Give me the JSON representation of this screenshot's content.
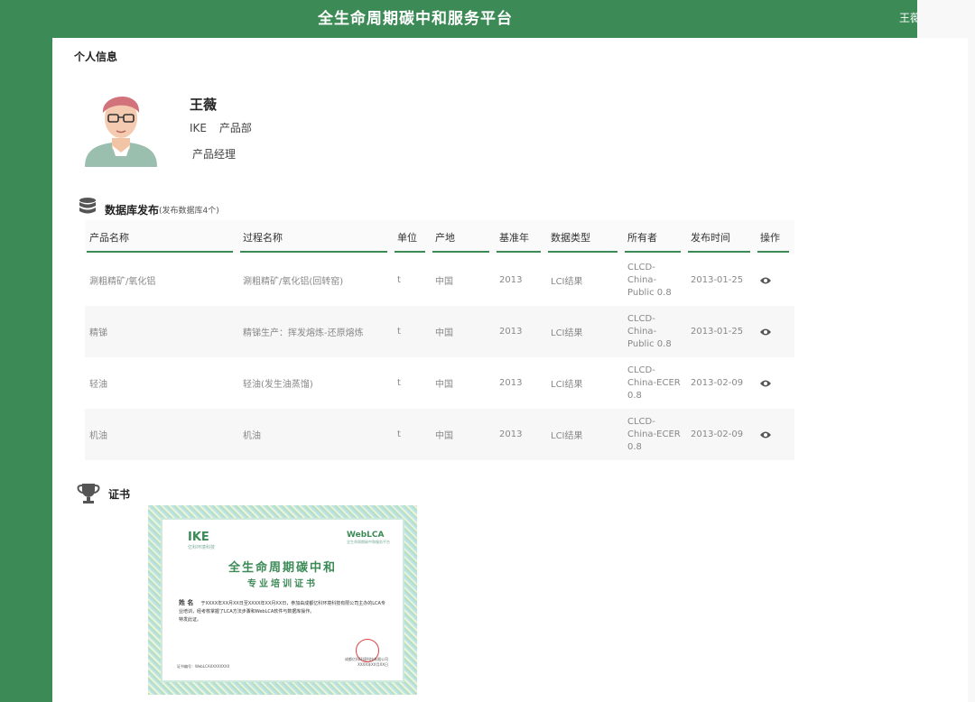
{
  "app": {
    "title": "全生命周期碳中和服务平台",
    "user_name": "王薇"
  },
  "profile": {
    "section_title": "个人信息",
    "name": "王薇",
    "company": "IKE",
    "department": "产品部",
    "role": "产品经理"
  },
  "database": {
    "title": "数据库发布",
    "subtitle": "(发布数据库4个)",
    "columns": [
      "产品名称",
      "过程名称",
      "单位",
      "产地",
      "基准年",
      "数据类型",
      "所有者",
      "发布时间",
      "操作"
    ],
    "rows": [
      {
        "product": "涮粗精矿/氧化铝",
        "process": "涮粗精矿/氧化铝(回转窑)",
        "unit": "t",
        "origin": "中国",
        "year": "2013",
        "type": "LCI结果",
        "owner": "CLCD-China-Public 0.8",
        "date": "2013-01-25"
      },
      {
        "product": "精锑",
        "process": "精锑生产：挥发熔炼-还原熔炼",
        "unit": "t",
        "origin": "中国",
        "year": "2013",
        "type": "LCI结果",
        "owner": "CLCD-China-Public 0.8",
        "date": "2013-01-25"
      },
      {
        "product": "轻油",
        "process": "轻油(发生油蒸馏)",
        "unit": "t",
        "origin": "中国",
        "year": "2013",
        "type": "LCI结果",
        "owner": "CLCD-China-ECER 0.8",
        "date": "2013-02-09"
      },
      {
        "product": "机油",
        "process": "机油",
        "unit": "t",
        "origin": "中国",
        "year": "2013",
        "type": "LCI结果",
        "owner": "CLCD-China-ECER 0.8",
        "date": "2013-02-09"
      }
    ]
  },
  "certificate": {
    "section_title": "证书",
    "logo_left": "IKE",
    "logo_left_sub": "亿科环境科技",
    "logo_right": "WebLCA",
    "logo_right_sub": "全生命周期碳中和服务平台",
    "heading_1": "全生命周期碳中和",
    "heading_2": "专业培训证书",
    "name_label": "姓  名",
    "body": "于XXXX年XX月XX日至XXXX年XX月XX日，参加由成都亿科环境科技有限公司主办的LCA专业培训，经考核掌握了LCA方法步骤和WebLCA软件与数据库操作。",
    "body_end": "特发此证。",
    "cert_no": "证书编号：WebLCAXXXXXXXX",
    "issuer": "成都亿科环境科技有限公司",
    "issue_date": "XXXX年XX月XX日"
  },
  "colors": {
    "brand": "#3c8a56"
  }
}
